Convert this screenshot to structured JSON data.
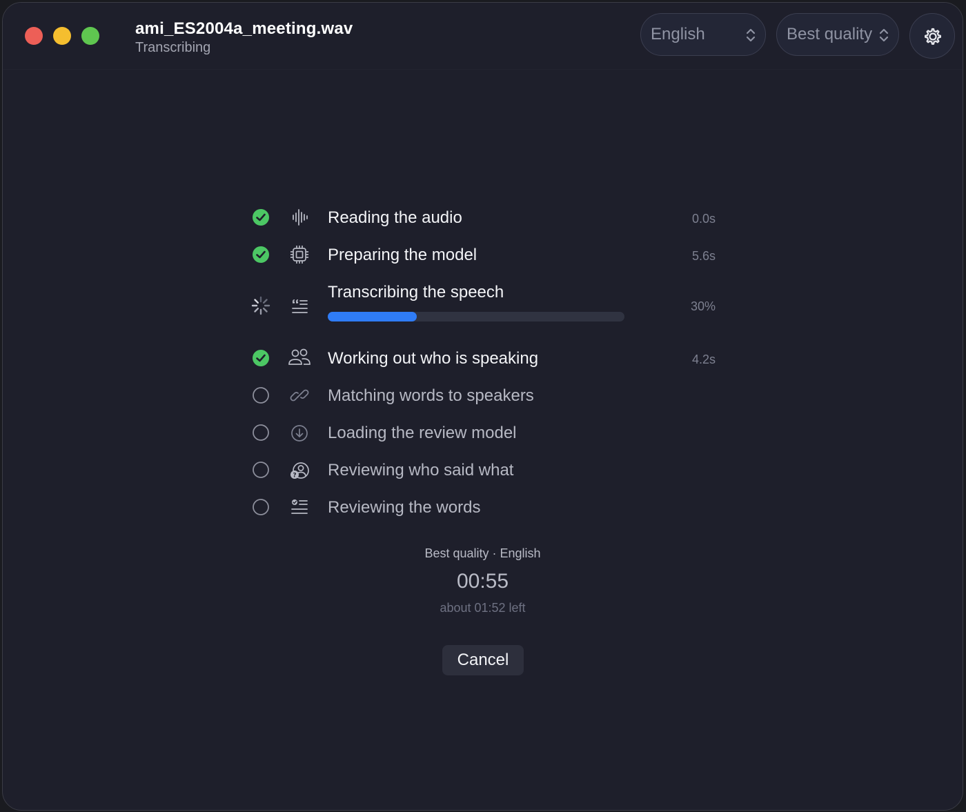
{
  "window": {
    "title": "ami_ES2004a_meeting.wav",
    "subtitle": "Transcribing"
  },
  "toolbar": {
    "language": "English",
    "quality": "Best quality"
  },
  "steps": [
    {
      "label": "Reading the audio",
      "meta": "0.0s",
      "status": "done",
      "icon": "waveform-icon"
    },
    {
      "label": "Preparing the model",
      "meta": "5.6s",
      "status": "done",
      "icon": "chip-icon"
    },
    {
      "label": "Transcribing the speech",
      "meta": "30%",
      "status": "in-progress",
      "icon": "quote-text-icon",
      "progress": 0.3
    },
    {
      "label": "Working out who is speaking",
      "meta": "4.2s",
      "status": "done",
      "icon": "people-icon"
    },
    {
      "label": "Matching words to speakers",
      "meta": "",
      "status": "pending",
      "icon": "link-icon"
    },
    {
      "label": "Loading the review model",
      "meta": "",
      "status": "pending",
      "icon": "download-circle-icon"
    },
    {
      "label": "Reviewing who said what",
      "meta": "",
      "status": "pending",
      "icon": "person-question-icon"
    },
    {
      "label": "Reviewing the words",
      "meta": "",
      "status": "pending",
      "icon": "checklist-icon"
    }
  ],
  "summary": {
    "settings": "Best quality · English",
    "elapsed": "00:55",
    "remaining": "about 01:52 left"
  },
  "actions": {
    "cancel_label": "Cancel"
  },
  "colors": {
    "background": "#1e1f2b",
    "accent": "#2f7cf6",
    "success": "#4cc764"
  }
}
